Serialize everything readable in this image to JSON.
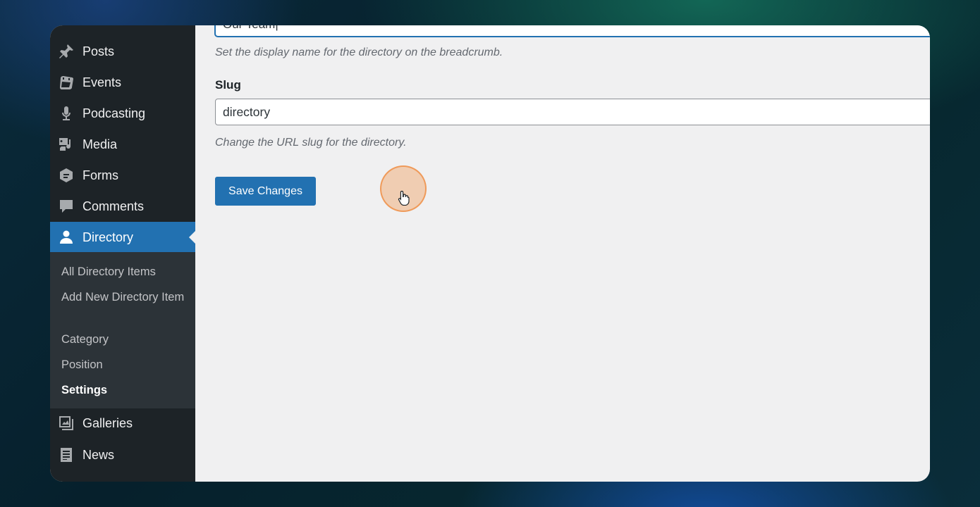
{
  "sidebar": {
    "items": [
      {
        "label": "Posts",
        "icon": "pin-icon"
      },
      {
        "label": "Events",
        "icon": "calendar-icon"
      },
      {
        "label": "Podcasting",
        "icon": "microphone-icon"
      },
      {
        "label": "Media",
        "icon": "media-icon"
      },
      {
        "label": "Forms",
        "icon": "forms-icon"
      },
      {
        "label": "Comments",
        "icon": "comment-icon"
      },
      {
        "label": "Directory",
        "icon": "person-icon",
        "active": true
      },
      {
        "label": "Galleries",
        "icon": "gallery-icon"
      },
      {
        "label": "News",
        "icon": "document-icon"
      }
    ],
    "submenu": [
      {
        "label": "All Directory Items"
      },
      {
        "label": "Add New Directory Item"
      },
      {
        "label": "Category"
      },
      {
        "label": "Position"
      },
      {
        "label": "Settings",
        "current": true
      }
    ]
  },
  "settings": {
    "display_name_value": "Our Team|",
    "display_name_desc": "Set the display name for the directory on the breadcrumb.",
    "slug_label": "Slug",
    "slug_value": "directory",
    "slug_desc": "Change the URL slug for the directory.",
    "save_label": "Save Changes"
  },
  "colors": {
    "accent": "#2271b1",
    "sidebar_bg": "#1d2327",
    "submenu_bg": "#2c3338",
    "content_bg": "#f0f0f1"
  }
}
